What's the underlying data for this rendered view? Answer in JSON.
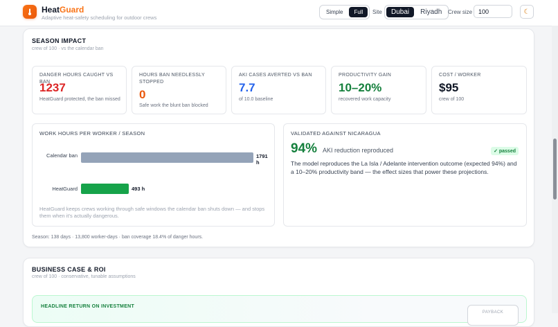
{
  "app": {
    "name_prefix": "Heat",
    "name_accent": "Guard",
    "tagline": "Adaptive heat-safety scheduling for outdoor crews",
    "accent_color": "#f97316"
  },
  "controls": {
    "mode_options": [
      "Simple",
      "Full"
    ],
    "mode_selected": "Full",
    "site_label": "Site",
    "site_options": [
      "Dubai",
      "Riyadh"
    ],
    "site_selected": "Dubai",
    "crew_label": "Crew size",
    "crew_value": "100",
    "theme_icon": "moon-icon"
  },
  "season_impact": {
    "title": "SEASON IMPACT",
    "subtitle": "crew of 100 · vs the calendar ban",
    "kpis": [
      {
        "label": "DANGER HOURS CAUGHT VS BAN",
        "value": "1237",
        "note": "HeatGuard protected, the ban missed",
        "color": "#dc2626"
      },
      {
        "label": "HOURS BAN NEEDLESSLY STOPPED",
        "value": "0",
        "note": "Safe work the blunt ban blocked",
        "color": "#ea580c"
      },
      {
        "label": "AKI CASES AVERTED VS BAN",
        "value": "7.7",
        "note": "of 10.0 baseline",
        "color": "#2563eb"
      },
      {
        "label": "PRODUCTIVITY GAIN",
        "value": "10–20%",
        "note": "recovered work capacity",
        "color": "#15803d"
      },
      {
        "label": "COST / WORKER",
        "value": "$95",
        "note": "crew of 100",
        "color": "#111827"
      }
    ],
    "work_hours": {
      "title": "WORK HOURS PER WORKER / SEASON",
      "note": "HeatGuard keeps crews working through safe windows the calendar ban shuts down — and stops them when it's actually dangerous."
    },
    "chart_data": {
      "type": "bar",
      "orientation": "horizontal",
      "categories": [
        "Calendar ban",
        "HeatGuard"
      ],
      "values": [
        1791,
        493
      ],
      "value_labels": [
        "1791 h",
        "493 h"
      ],
      "colors": [
        "#94a3b8",
        "#16a34a"
      ],
      "title": "WORK HOURS PER WORKER / SEASON",
      "xlabel": "",
      "ylabel": ""
    },
    "validation": {
      "title": "VALIDATED AGAINST NICARAGUA",
      "big_value": "94%",
      "big_note": "AKI reduction reproduced",
      "badge": "✓ passed",
      "body": "The model reproduces the La Isla / Adelante intervention outcome (expected 94%) and a 10–20% productivity band — the effect sizes that power these projections."
    },
    "footer": "Season: 138 days · 13,800 worker-days · ban coverage 18.4% of danger hours."
  },
  "business_case": {
    "title": "BUSINESS CASE & ROI",
    "subtitle": "crew of 100 · conservative, tunable assumptions",
    "headline_label": "HEADLINE RETURN ON INVESTMENT",
    "payback_label": "PAYBACK"
  }
}
